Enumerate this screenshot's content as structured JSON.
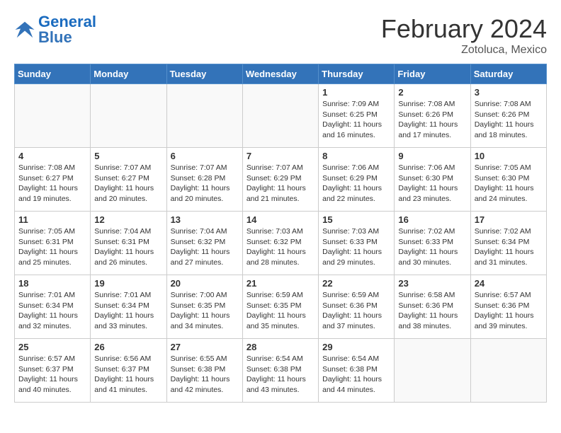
{
  "header": {
    "logo_general": "General",
    "logo_blue": "Blue",
    "month_year": "February 2024",
    "location": "Zotoluca, Mexico"
  },
  "days_of_week": [
    "Sunday",
    "Monday",
    "Tuesday",
    "Wednesday",
    "Thursday",
    "Friday",
    "Saturday"
  ],
  "weeks": [
    [
      {
        "day": "",
        "info": ""
      },
      {
        "day": "",
        "info": ""
      },
      {
        "day": "",
        "info": ""
      },
      {
        "day": "",
        "info": ""
      },
      {
        "day": "1",
        "info": "Sunrise: 7:09 AM\nSunset: 6:25 PM\nDaylight: 11 hours and 16 minutes."
      },
      {
        "day": "2",
        "info": "Sunrise: 7:08 AM\nSunset: 6:26 PM\nDaylight: 11 hours and 17 minutes."
      },
      {
        "day": "3",
        "info": "Sunrise: 7:08 AM\nSunset: 6:26 PM\nDaylight: 11 hours and 18 minutes."
      }
    ],
    [
      {
        "day": "4",
        "info": "Sunrise: 7:08 AM\nSunset: 6:27 PM\nDaylight: 11 hours and 19 minutes."
      },
      {
        "day": "5",
        "info": "Sunrise: 7:07 AM\nSunset: 6:27 PM\nDaylight: 11 hours and 20 minutes."
      },
      {
        "day": "6",
        "info": "Sunrise: 7:07 AM\nSunset: 6:28 PM\nDaylight: 11 hours and 20 minutes."
      },
      {
        "day": "7",
        "info": "Sunrise: 7:07 AM\nSunset: 6:29 PM\nDaylight: 11 hours and 21 minutes."
      },
      {
        "day": "8",
        "info": "Sunrise: 7:06 AM\nSunset: 6:29 PM\nDaylight: 11 hours and 22 minutes."
      },
      {
        "day": "9",
        "info": "Sunrise: 7:06 AM\nSunset: 6:30 PM\nDaylight: 11 hours and 23 minutes."
      },
      {
        "day": "10",
        "info": "Sunrise: 7:05 AM\nSunset: 6:30 PM\nDaylight: 11 hours and 24 minutes."
      }
    ],
    [
      {
        "day": "11",
        "info": "Sunrise: 7:05 AM\nSunset: 6:31 PM\nDaylight: 11 hours and 25 minutes."
      },
      {
        "day": "12",
        "info": "Sunrise: 7:04 AM\nSunset: 6:31 PM\nDaylight: 11 hours and 26 minutes."
      },
      {
        "day": "13",
        "info": "Sunrise: 7:04 AM\nSunset: 6:32 PM\nDaylight: 11 hours and 27 minutes."
      },
      {
        "day": "14",
        "info": "Sunrise: 7:03 AM\nSunset: 6:32 PM\nDaylight: 11 hours and 28 minutes."
      },
      {
        "day": "15",
        "info": "Sunrise: 7:03 AM\nSunset: 6:33 PM\nDaylight: 11 hours and 29 minutes."
      },
      {
        "day": "16",
        "info": "Sunrise: 7:02 AM\nSunset: 6:33 PM\nDaylight: 11 hours and 30 minutes."
      },
      {
        "day": "17",
        "info": "Sunrise: 7:02 AM\nSunset: 6:34 PM\nDaylight: 11 hours and 31 minutes."
      }
    ],
    [
      {
        "day": "18",
        "info": "Sunrise: 7:01 AM\nSunset: 6:34 PM\nDaylight: 11 hours and 32 minutes."
      },
      {
        "day": "19",
        "info": "Sunrise: 7:01 AM\nSunset: 6:34 PM\nDaylight: 11 hours and 33 minutes."
      },
      {
        "day": "20",
        "info": "Sunrise: 7:00 AM\nSunset: 6:35 PM\nDaylight: 11 hours and 34 minutes."
      },
      {
        "day": "21",
        "info": "Sunrise: 6:59 AM\nSunset: 6:35 PM\nDaylight: 11 hours and 35 minutes."
      },
      {
        "day": "22",
        "info": "Sunrise: 6:59 AM\nSunset: 6:36 PM\nDaylight: 11 hours and 37 minutes."
      },
      {
        "day": "23",
        "info": "Sunrise: 6:58 AM\nSunset: 6:36 PM\nDaylight: 11 hours and 38 minutes."
      },
      {
        "day": "24",
        "info": "Sunrise: 6:57 AM\nSunset: 6:36 PM\nDaylight: 11 hours and 39 minutes."
      }
    ],
    [
      {
        "day": "25",
        "info": "Sunrise: 6:57 AM\nSunset: 6:37 PM\nDaylight: 11 hours and 40 minutes."
      },
      {
        "day": "26",
        "info": "Sunrise: 6:56 AM\nSunset: 6:37 PM\nDaylight: 11 hours and 41 minutes."
      },
      {
        "day": "27",
        "info": "Sunrise: 6:55 AM\nSunset: 6:38 PM\nDaylight: 11 hours and 42 minutes."
      },
      {
        "day": "28",
        "info": "Sunrise: 6:54 AM\nSunset: 6:38 PM\nDaylight: 11 hours and 43 minutes."
      },
      {
        "day": "29",
        "info": "Sunrise: 6:54 AM\nSunset: 6:38 PM\nDaylight: 11 hours and 44 minutes."
      },
      {
        "day": "",
        "info": ""
      },
      {
        "day": "",
        "info": ""
      }
    ]
  ]
}
